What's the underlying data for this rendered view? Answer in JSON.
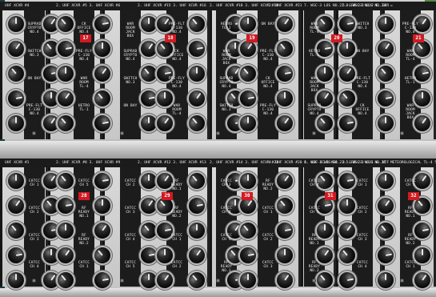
{
  "photo": {
    "colors": {
      "panel": "#cfcfcf",
      "knob": "#0b0b0b",
      "tag": "#d11a22",
      "strip": "#1c1c1c"
    },
    "top_row": {
      "headers": [
        "UHF XCVR #4",
        "2. UHF XCVR #5  3. UHF XCVR #6",
        "2. UHF XCVR #15  3. UHF XCVR #16",
        "2. UHF XCVR #18  3. UHF XCVR #19",
        "2. UHF XCVR #21",
        "7. WSC-3 LOS NO.22  8. WSC-3 LOS NO.24",
        "5. GRR-23 NO.2  6. GRR",
        "="
      ],
      "tags": [
        "17",
        "18",
        "19",
        "20",
        "21"
      ],
      "labels": [
        "SUPRAD\nCRYPTO\nNO.4",
        "SWITCH\nNO.3",
        "ON BAY",
        "PRE-FLT\nC-130\nNO.4",
        "CK\nOFFICE\nNO.4",
        "PRE-FLY\nC-130\nNO.4",
        "WAR\nROOM\nTL-4",
        "HETRO\nTL-1",
        "WAR\nROOM\nJACK\nBOX"
      ]
    },
    "bottom_row": {
      "headers": [
        "UHF XCVR #1",
        "2. UHF XCVR #8  3. UHF XCVR #9",
        "2. UHF XCVR #12  3. UHF XCVR #13",
        "2. UHF XCVR #14  3. UHF XCVR #23",
        "4. UHF XCVR #20  5. UHF XCVR #24",
        "4. WSC-3 LOS NO.23  5. WSC-3 LOS NO.25",
        "3. GRR-23 NO.1  4. NTF",
        "METEOROLOGICAL TL-4  5. SUP-RAD TL-1"
      ],
      "tags": [
        "28",
        "29",
        "30",
        "31",
        "32"
      ],
      "labels": [
        "CATCC\nCH 1",
        "CATCC\nCH 2",
        "CATCC\nCH 3",
        "CATCC\nCH 4",
        "CATCC\nCH 5",
        "RF\nREADY\nNO.1",
        "RF\nREADY\nNO.2"
      ]
    }
  }
}
